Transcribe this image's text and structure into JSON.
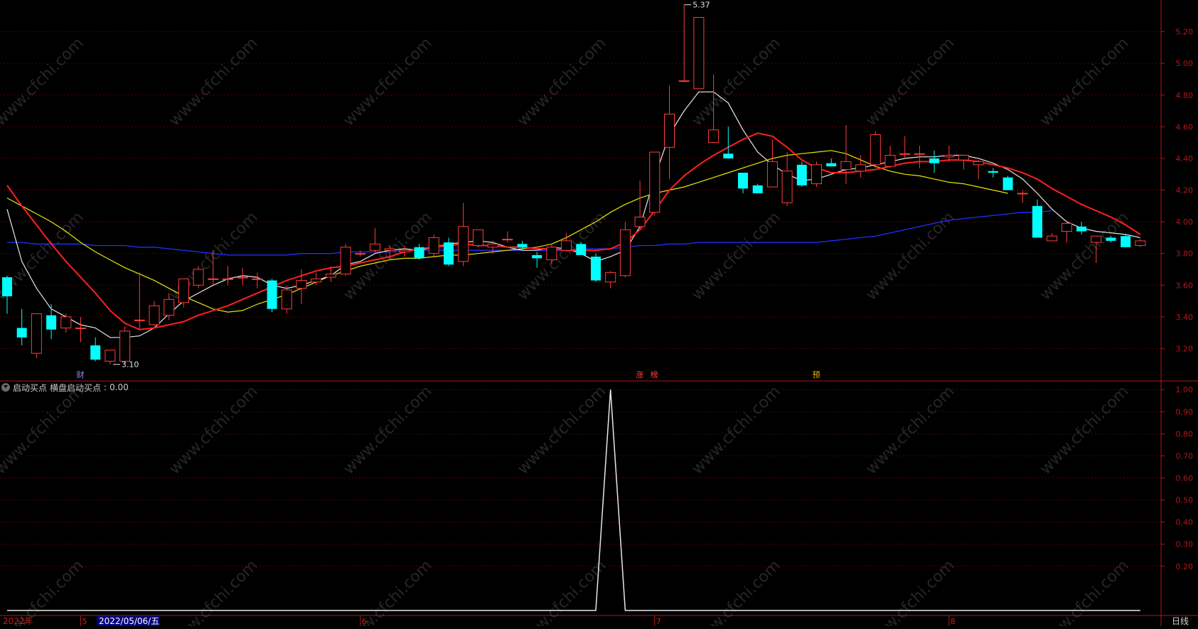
{
  "indicator": {
    "name": "启动买点",
    "line_label": "横盘启动买点",
    "line_value": "0.00"
  },
  "period_label": "日线",
  "bottom_axis": {
    "year_label": "2022年",
    "months": [
      "5",
      "6",
      "7",
      "8"
    ],
    "cursor_date": "2022/05/06/五"
  },
  "markers": {
    "high_label": "5.37",
    "low_label": "3.10",
    "events": [
      "财",
      "涨",
      "榜",
      "预"
    ]
  },
  "watermark": "www.cfchi.com",
  "colors": {
    "up": "#ff3c3c",
    "down": "#00ffff",
    "ma5": "#e8e8e8",
    "ma10": "#ff2020",
    "ma20": "#e8e800",
    "ma60": "#2030ff",
    "axis": "#b01818",
    "grid": "#5a0000",
    "indicator_line": "#e8e8e8"
  },
  "chart_data": [
    {
      "type": "candlestick",
      "title": "",
      "y_ticks": [
        3.2,
        3.4,
        3.6,
        3.8,
        4.0,
        4.2,
        4.4,
        4.6,
        4.8,
        5.0,
        5.2
      ],
      "ylim": [
        3.0,
        5.4
      ],
      "grid": true,
      "candles": [
        [
          3.65,
          3.66,
          3.42,
          3.53
        ],
        [
          3.33,
          3.45,
          3.22,
          3.27
        ],
        [
          3.17,
          3.42,
          3.14,
          3.42
        ],
        [
          3.41,
          3.48,
          3.26,
          3.32
        ],
        [
          3.33,
          3.42,
          3.3,
          3.4
        ],
        [
          3.33,
          3.4,
          3.24,
          3.33
        ],
        [
          3.22,
          3.27,
          3.12,
          3.13
        ],
        [
          3.12,
          3.19,
          3.1,
          3.19
        ],
        [
          3.12,
          3.34,
          3.1,
          3.31
        ],
        [
          3.38,
          3.68,
          3.32,
          3.38
        ],
        [
          3.35,
          3.5,
          3.34,
          3.47
        ],
        [
          3.41,
          3.55,
          3.38,
          3.51
        ],
        [
          3.49,
          3.64,
          3.46,
          3.64
        ],
        [
          3.6,
          3.72,
          3.58,
          3.7
        ],
        [
          3.64,
          3.82,
          3.6,
          3.64
        ],
        [
          3.64,
          3.72,
          3.6,
          3.64
        ],
        [
          3.65,
          3.71,
          3.6,
          3.65
        ],
        [
          3.64,
          3.68,
          3.58,
          3.64
        ],
        [
          3.63,
          3.64,
          3.43,
          3.45
        ],
        [
          3.45,
          3.6,
          3.42,
          3.57
        ],
        [
          3.58,
          3.7,
          3.48,
          3.63
        ],
        [
          3.62,
          3.68,
          3.6,
          3.64
        ],
        [
          3.65,
          3.72,
          3.62,
          3.67
        ],
        [
          3.67,
          3.86,
          3.66,
          3.84
        ],
        [
          3.8,
          3.82,
          3.78,
          3.8
        ],
        [
          3.82,
          3.96,
          3.8,
          3.86
        ],
        [
          3.82,
          3.85,
          3.76,
          3.83
        ],
        [
          3.81,
          3.85,
          3.78,
          3.82
        ],
        [
          3.84,
          3.86,
          3.76,
          3.77
        ],
        [
          3.8,
          3.92,
          3.78,
          3.9
        ],
        [
          3.87,
          3.9,
          3.72,
          3.73
        ],
        [
          3.75,
          4.12,
          3.72,
          3.97
        ],
        [
          3.85,
          3.95,
          3.84,
          3.95
        ],
        [
          3.84,
          3.88,
          3.8,
          3.86
        ],
        [
          3.89,
          3.94,
          3.87,
          3.89
        ],
        [
          3.86,
          3.88,
          3.82,
          3.84
        ],
        [
          3.79,
          3.81,
          3.71,
          3.77
        ],
        [
          3.76,
          3.86,
          3.73,
          3.84
        ],
        [
          3.82,
          3.93,
          3.81,
          3.88
        ],
        [
          3.86,
          3.87,
          3.82,
          3.79
        ],
        [
          3.78,
          3.8,
          3.62,
          3.63
        ],
        [
          3.62,
          3.69,
          3.58,
          3.68
        ],
        [
          3.66,
          4.0,
          3.65,
          3.95
        ],
        [
          3.97,
          4.26,
          3.96,
          4.03
        ],
        [
          4.06,
          4.44,
          4.04,
          4.44
        ],
        [
          4.47,
          4.86,
          4.27,
          4.68
        ],
        [
          4.89,
          5.37,
          4.89,
          4.89
        ],
        [
          4.84,
          5.29,
          4.84,
          5.29
        ],
        [
          4.5,
          4.93,
          4.5,
          4.58
        ],
        [
          4.43,
          4.6,
          4.4,
          4.4
        ],
        [
          4.31,
          4.31,
          4.18,
          4.21
        ],
        [
          4.23,
          4.24,
          4.2,
          4.18
        ],
        [
          4.22,
          4.52,
          4.24,
          4.38
        ],
        [
          4.12,
          4.44,
          4.1,
          4.32
        ],
        [
          4.36,
          4.38,
          4.22,
          4.23
        ],
        [
          4.24,
          4.38,
          4.22,
          4.36
        ],
        [
          4.37,
          4.4,
          4.35,
          4.35
        ],
        [
          4.33,
          4.61,
          4.24,
          4.38
        ],
        [
          4.32,
          4.42,
          4.28,
          4.36
        ],
        [
          4.36,
          4.57,
          4.34,
          4.55
        ],
        [
          4.35,
          4.48,
          4.34,
          4.42
        ],
        [
          4.43,
          4.54,
          4.4,
          4.43
        ],
        [
          4.43,
          4.48,
          4.34,
          4.43
        ],
        [
          4.4,
          4.45,
          4.31,
          4.37
        ],
        [
          4.41,
          4.48,
          4.38,
          4.42
        ],
        [
          4.39,
          4.42,
          4.33,
          4.42
        ],
        [
          4.36,
          4.39,
          4.27,
          4.38
        ],
        [
          4.32,
          4.34,
          4.28,
          4.31
        ],
        [
          4.28,
          4.29,
          4.2,
          4.2
        ],
        [
          4.18,
          4.2,
          4.12,
          4.18
        ],
        [
          4.1,
          4.14,
          3.91,
          3.9
        ],
        [
          3.88,
          3.93,
          3.88,
          3.91
        ],
        [
          3.94,
          4.0,
          3.87,
          3.99
        ],
        [
          3.97,
          4.0,
          3.92,
          3.94
        ],
        [
          3.87,
          3.9,
          3.74,
          3.91
        ],
        [
          3.9,
          3.91,
          3.87,
          3.88
        ],
        [
          3.91,
          3.92,
          3.84,
          3.84
        ],
        [
          3.85,
          3.89,
          3.84,
          3.88
        ]
      ],
      "ma5": [
        4.08,
        3.75,
        3.58,
        3.45,
        3.4,
        3.35,
        3.33,
        3.27,
        3.27,
        3.28,
        3.33,
        3.42,
        3.5,
        3.55,
        3.6,
        3.64,
        3.66,
        3.65,
        3.6,
        3.58,
        3.6,
        3.63,
        3.66,
        3.73,
        3.75,
        3.8,
        3.82,
        3.83,
        3.82,
        3.84,
        3.86,
        3.87,
        3.88,
        3.87,
        3.84,
        3.82,
        3.82,
        3.84,
        3.83,
        3.8,
        3.75,
        3.78,
        3.82,
        3.97,
        4.28,
        4.55,
        4.7,
        4.82,
        4.82,
        4.75,
        4.58,
        4.44,
        4.36,
        4.3,
        4.26,
        4.27,
        4.3,
        4.33,
        4.34,
        4.36,
        4.38,
        4.4,
        4.41,
        4.41,
        4.42,
        4.42,
        4.4,
        4.37,
        4.33,
        4.27,
        4.18,
        4.08,
        4.0,
        3.96,
        3.94,
        3.93,
        3.92,
        3.9
      ],
      "ma10": [
        4.23,
        4.1,
        3.98,
        3.86,
        3.75,
        3.65,
        3.55,
        3.44,
        3.36,
        3.32,
        3.33,
        3.35,
        3.37,
        3.41,
        3.44,
        3.47,
        3.51,
        3.55,
        3.59,
        3.63,
        3.66,
        3.69,
        3.71,
        3.72,
        3.74,
        3.76,
        3.78,
        3.81,
        3.83,
        3.84,
        3.85,
        3.86,
        3.85,
        3.85,
        3.84,
        3.84,
        3.83,
        3.83,
        3.82,
        3.82,
        3.82,
        3.83,
        3.87,
        3.95,
        4.07,
        4.2,
        4.29,
        4.36,
        4.42,
        4.47,
        4.52,
        4.56,
        4.54,
        4.47,
        4.39,
        4.34,
        4.31,
        4.31,
        4.32,
        4.33,
        4.35,
        4.37,
        4.38,
        4.38,
        4.39,
        4.39,
        4.38,
        4.36,
        4.34,
        4.31,
        4.27,
        4.21,
        4.16,
        4.11,
        4.07,
        4.03,
        3.98,
        3.92
      ],
      "ma20": [
        4.15,
        4.1,
        4.05,
        4.0,
        3.94,
        3.87,
        3.81,
        3.76,
        3.71,
        3.67,
        3.63,
        3.58,
        3.53,
        3.49,
        3.45,
        3.43,
        3.44,
        3.48,
        3.51,
        3.54,
        3.58,
        3.62,
        3.66,
        3.69,
        3.72,
        3.74,
        3.76,
        3.77,
        3.77,
        3.78,
        3.79,
        3.79,
        3.8,
        3.81,
        3.82,
        3.83,
        3.84,
        3.86,
        3.9,
        3.95,
        4.0,
        4.06,
        4.11,
        4.15,
        4.18,
        4.2,
        4.22,
        4.25,
        4.28,
        4.31,
        4.34,
        4.37,
        4.4,
        4.42,
        4.43,
        4.44,
        4.45,
        4.43,
        4.39,
        4.35,
        4.32,
        4.3,
        4.29,
        4.27,
        4.25,
        4.24,
        4.22,
        4.2,
        4.18
      ],
      "ma60": [
        3.87,
        3.87,
        3.86,
        3.86,
        3.86,
        3.86,
        3.85,
        3.85,
        3.85,
        3.84,
        3.84,
        3.83,
        3.82,
        3.81,
        3.8,
        3.79,
        3.79,
        3.79,
        3.79,
        3.79,
        3.8,
        3.8,
        3.8,
        3.81,
        3.81,
        3.81,
        3.81,
        3.82,
        3.82,
        3.82,
        3.82,
        3.82,
        3.82,
        3.82,
        3.82,
        3.82,
        3.82,
        3.82,
        3.82,
        3.83,
        3.83,
        3.83,
        3.84,
        3.85,
        3.85,
        3.86,
        3.86,
        3.87,
        3.87,
        3.87,
        3.87,
        3.87,
        3.87,
        3.87,
        3.87,
        3.87,
        3.88,
        3.89,
        3.9,
        3.91,
        3.93,
        3.95,
        3.97,
        3.99,
        4.01,
        4.02,
        4.03,
        4.04,
        4.05,
        4.06,
        4.06,
        4.07
      ]
    },
    {
      "type": "line",
      "title": "",
      "series": [
        {
          "name": "横盘启动买点",
          "values": [
            0,
            0,
            0,
            0,
            0,
            0,
            0,
            0,
            0,
            0,
            0,
            0,
            0,
            0,
            0,
            0,
            0,
            0,
            0,
            0,
            0,
            0,
            0,
            0,
            0,
            0,
            0,
            0,
            0,
            0,
            0,
            0,
            0,
            0,
            0,
            0,
            0,
            0,
            0,
            0,
            0,
            0,
            0,
            0,
            0,
            0,
            0,
            0,
            0,
            0,
            0,
            0,
            0,
            0,
            0,
            0,
            0,
            0,
            0,
            0,
            0,
            0,
            0,
            0,
            0,
            0,
            0,
            0,
            0,
            0,
            0,
            0,
            0,
            0,
            0,
            0,
            0,
            0
          ]
        }
      ],
      "spike": {
        "index": 41,
        "value": 1.0
      },
      "y_ticks": [
        0.2,
        0.3,
        0.4,
        0.5,
        0.6,
        0.7,
        0.8,
        0.9,
        1.0
      ],
      "ylim": [
        -0.01,
        1.02
      ],
      "grid": true
    }
  ]
}
